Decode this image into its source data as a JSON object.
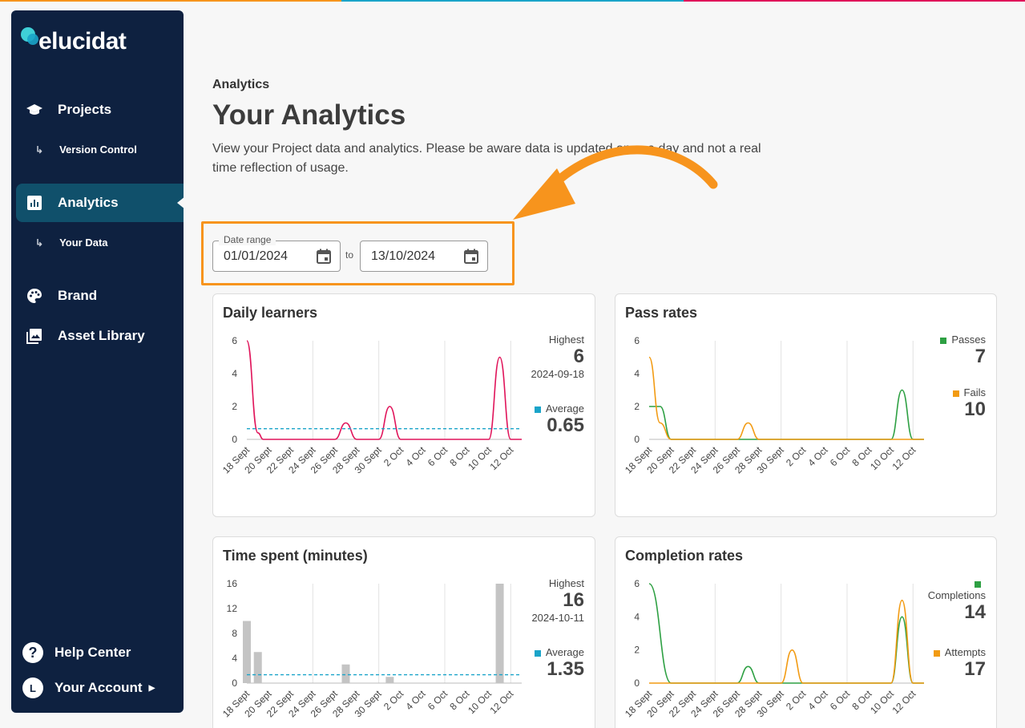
{
  "colors": {
    "sidebar": "#0e2140",
    "active": "#10506b",
    "accent": "#f7941d",
    "learners": "#e0145a",
    "average": "#1aa4c9",
    "passes": "#2ea043",
    "fails": "#f29b13",
    "bars": "#c4c4c4"
  },
  "logo": {
    "text": "elucidat"
  },
  "sidebar": {
    "projects": {
      "label": "Projects",
      "icon": "graduation-cap-icon"
    },
    "version_control": {
      "label": "Version Control"
    },
    "analytics": {
      "label": "Analytics",
      "icon": "bar-chart-icon"
    },
    "your_data": {
      "label": "Your Data"
    },
    "brand": {
      "label": "Brand",
      "icon": "palette-icon"
    },
    "asset_library": {
      "label": "Asset Library",
      "icon": "image-icon"
    },
    "help_center": {
      "label": "Help Center",
      "icon": "help-icon",
      "glyph": "?"
    },
    "your_account": {
      "label": "Your Account",
      "initial": "L"
    }
  },
  "page": {
    "breadcrumb": "Analytics",
    "title": "Your Analytics",
    "description": "View your Project data and analytics. Please be aware data is updated once a day and not a real time reflection of usage."
  },
  "date_range": {
    "label": "Date range",
    "start": "01/01/2024",
    "to": "to",
    "end": "13/10/2024"
  },
  "x_ticks": [
    "18 Sept",
    "20 Sept",
    "22 Sept",
    "24 Sept",
    "26 Sept",
    "28 Sept",
    "30 Sept",
    "2 Oct",
    "4 Oct",
    "6 Oct",
    "8 Oct",
    "10 Oct",
    "12 Oct"
  ],
  "cards": {
    "daily": {
      "title": "Daily learners",
      "highest_label": "Highest",
      "highest_value": "6",
      "highest_date": "2024-09-18",
      "average_label": "Average",
      "average_value": "0.65"
    },
    "pass": {
      "title": "Pass rates",
      "passes_label": "Passes",
      "passes_value": "7",
      "fails_label": "Fails",
      "fails_value": "10"
    },
    "time": {
      "title": "Time spent (minutes)",
      "highest_label": "Highest",
      "highest_value": "16",
      "highest_date": "2024-10-11",
      "average_label": "Average",
      "average_value": "1.35"
    },
    "completion": {
      "title": "Completion rates",
      "completions_label": "Completions",
      "completions_value": "14",
      "attempts_label": "Attempts",
      "attempts_value": "17"
    }
  },
  "chart_data": [
    {
      "type": "line",
      "title": "Daily learners",
      "x": [
        "18 Sept",
        "20 Sept",
        "22 Sept",
        "24 Sept",
        "26 Sept",
        "28 Sept",
        "30 Sept",
        "2 Oct",
        "4 Oct",
        "6 Oct",
        "8 Oct",
        "10 Oct",
        "12 Oct"
      ],
      "yticks": [
        0,
        2,
        4,
        6
      ],
      "ylim": [
        0,
        6
      ],
      "series": [
        {
          "values": [
            [
              0,
              6
            ],
            [
              1,
              0.4
            ],
            [
              1.5,
              0
            ],
            [
              8,
              0
            ],
            [
              9,
              1
            ],
            [
              10,
              0
            ],
            [
              12,
              0
            ],
            [
              13,
              2
            ],
            [
              14,
              0
            ],
            [
              22,
              0
            ],
            [
              23,
              5
            ],
            [
              24,
              0
            ],
            [
              25,
              0
            ]
          ]
        }
      ],
      "average": 0.65
    },
    {
      "type": "line",
      "title": "Pass rates",
      "x": [
        "18 Sept",
        "20 Sept",
        "22 Sept",
        "24 Sept",
        "26 Sept",
        "28 Sept",
        "30 Sept",
        "2 Oct",
        "4 Oct",
        "6 Oct",
        "8 Oct",
        "10 Oct",
        "12 Oct"
      ],
      "yticks": [
        0,
        2,
        4,
        6
      ],
      "ylim": [
        0,
        6
      ],
      "series": [
        {
          "name": "Passes",
          "values": [
            [
              0,
              2
            ],
            [
              1,
              2
            ],
            [
              2,
              0
            ],
            [
              22,
              0
            ],
            [
              23,
              3
            ],
            [
              24,
              0
            ],
            [
              25,
              0
            ]
          ]
        },
        {
          "name": "Fails",
          "values": [
            [
              0,
              5
            ],
            [
              1,
              1
            ],
            [
              2,
              0
            ],
            [
              8,
              0
            ],
            [
              9,
              1
            ],
            [
              10,
              0
            ],
            [
              25,
              0
            ]
          ]
        }
      ]
    },
    {
      "type": "bar",
      "title": "Time spent (minutes)",
      "x": [
        "18 Sept",
        "20 Sept",
        "22 Sept",
        "24 Sept",
        "26 Sept",
        "28 Sept",
        "30 Sept",
        "2 Oct",
        "4 Oct",
        "6 Oct",
        "8 Oct",
        "10 Oct",
        "12 Oct"
      ],
      "yticks": [
        0,
        4,
        8,
        12,
        16
      ],
      "ylim": [
        0,
        16
      ],
      "bars": [
        [
          0,
          10
        ],
        [
          1,
          5
        ],
        [
          9,
          3
        ],
        [
          13,
          1
        ],
        [
          23,
          16
        ]
      ],
      "average": 1.35
    },
    {
      "type": "line",
      "title": "Completion rates",
      "x": [
        "18 Sept",
        "20 Sept",
        "22 Sept",
        "24 Sept",
        "26 Sept",
        "28 Sept",
        "30 Sept",
        "2 Oct",
        "4 Oct",
        "6 Oct",
        "8 Oct",
        "10 Oct",
        "12 Oct"
      ],
      "yticks": [
        0,
        2,
        4,
        6
      ],
      "ylim": [
        0,
        6
      ],
      "series": [
        {
          "name": "Completions",
          "values": [
            [
              0,
              6
            ],
            [
              2,
              0
            ],
            [
              8,
              0
            ],
            [
              9,
              1
            ],
            [
              10,
              0
            ],
            [
              22,
              0
            ],
            [
              23,
              4
            ],
            [
              24,
              0
            ],
            [
              25,
              0
            ]
          ]
        },
        {
          "name": "Attempts",
          "values": [
            [
              0,
              0
            ],
            [
              12,
              0
            ],
            [
              13,
              2
            ],
            [
              14,
              0
            ],
            [
              22,
              0
            ],
            [
              23,
              5
            ],
            [
              24,
              0
            ],
            [
              25,
              0
            ]
          ]
        }
      ]
    }
  ]
}
